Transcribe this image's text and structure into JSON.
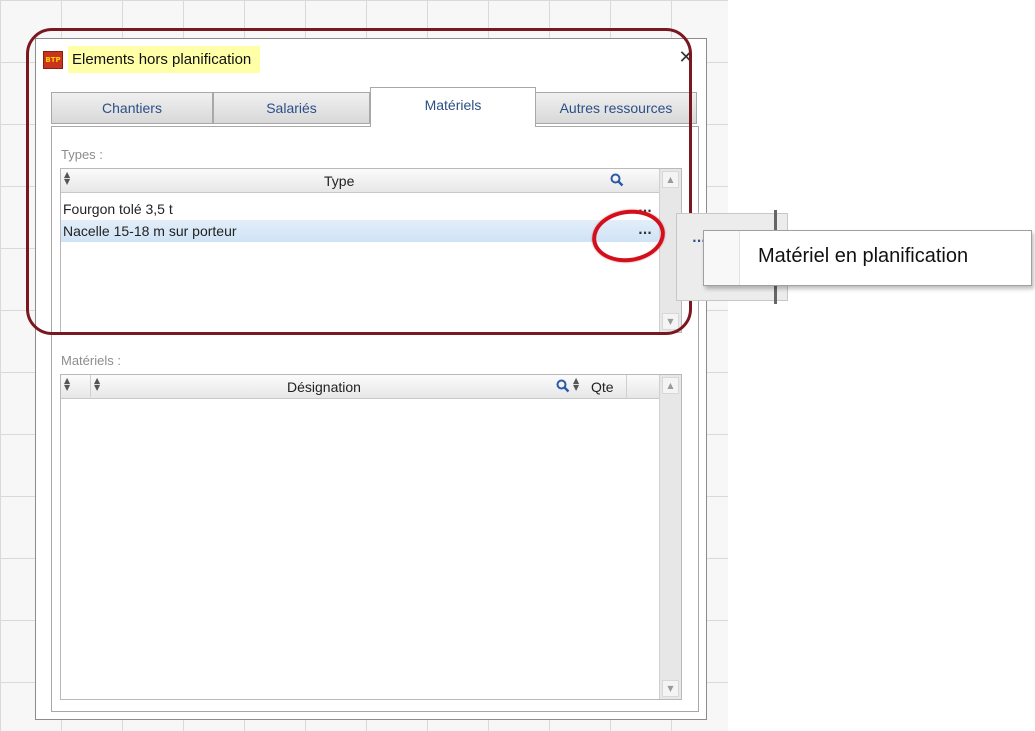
{
  "window": {
    "title": "Elements hors planification",
    "close_glyph": "✕",
    "app_icon_text": "BTP"
  },
  "tabs": [
    {
      "label": "Chantiers",
      "active": false
    },
    {
      "label": "Salariés",
      "active": false
    },
    {
      "label": "Matériels",
      "active": true
    },
    {
      "label": "Autres ressources",
      "active": false
    }
  ],
  "types_section": {
    "label": "Types :",
    "column_header": "Type",
    "rows": [
      {
        "label": "Fourgon tolé 3,5 t",
        "button": "...",
        "selected": false
      },
      {
        "label": "Nacelle 15-18 m sur porteur",
        "button": "...",
        "selected": true
      }
    ]
  },
  "materiels_section": {
    "label": "Matériels :",
    "columns": [
      "Désignation",
      "Qte"
    ],
    "rows": []
  },
  "context_menu": {
    "trigger_button": "...",
    "items": [
      "Matériel en planification"
    ]
  },
  "colors": {
    "annotation_rect": "#7b1720",
    "annotation_circle": "#d40f1c",
    "title_highlight": "#ffffa8",
    "tab_text": "#2c4f87",
    "selected_row": "#cfe3f5"
  },
  "icons": {
    "search": "magnifier-icon",
    "sort": "sort-arrows-icon",
    "close": "close-icon",
    "scroll_up": "chevron-up-icon",
    "scroll_down": "chevron-down-icon"
  }
}
